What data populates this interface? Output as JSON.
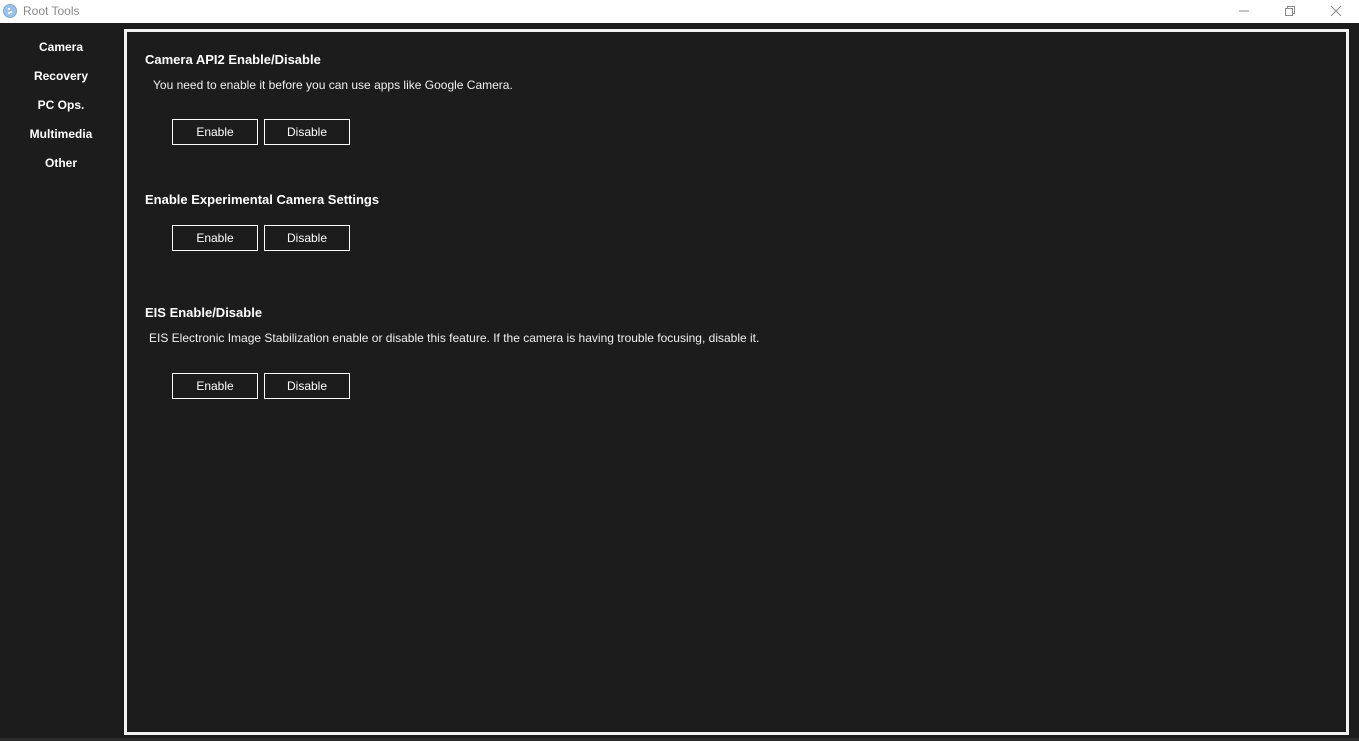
{
  "window": {
    "title": "Root Tools",
    "icon": "app-icon",
    "controls": [
      "minimize-icon",
      "restore-icon",
      "close-icon"
    ]
  },
  "sidebar": {
    "items": [
      {
        "label": "Camera"
      },
      {
        "label": "Recovery"
      },
      {
        "label": "PC Ops."
      },
      {
        "label": "Multimedia"
      },
      {
        "label": "Other"
      }
    ]
  },
  "sections": [
    {
      "title": "Camera API2 Enable/Disable",
      "description": "You need to enable it before you can use apps like Google Camera.",
      "enable_label": "Enable",
      "disable_label": "Disable"
    },
    {
      "title": "Enable Experimental Camera Settings",
      "enable_label": "Enable",
      "disable_label": "Disable"
    },
    {
      "title": "EIS Enable/Disable",
      "description": "EIS Electronic Image Stabilization enable or disable this feature. If the camera is having trouble focusing, disable it.",
      "enable_label": "Enable",
      "disable_label": "Disable"
    }
  ],
  "colors": {
    "background": "#1c1c1c",
    "panel_border": "#f2f2f2",
    "text": "#ffffff",
    "titlebar": "#ffffff"
  }
}
